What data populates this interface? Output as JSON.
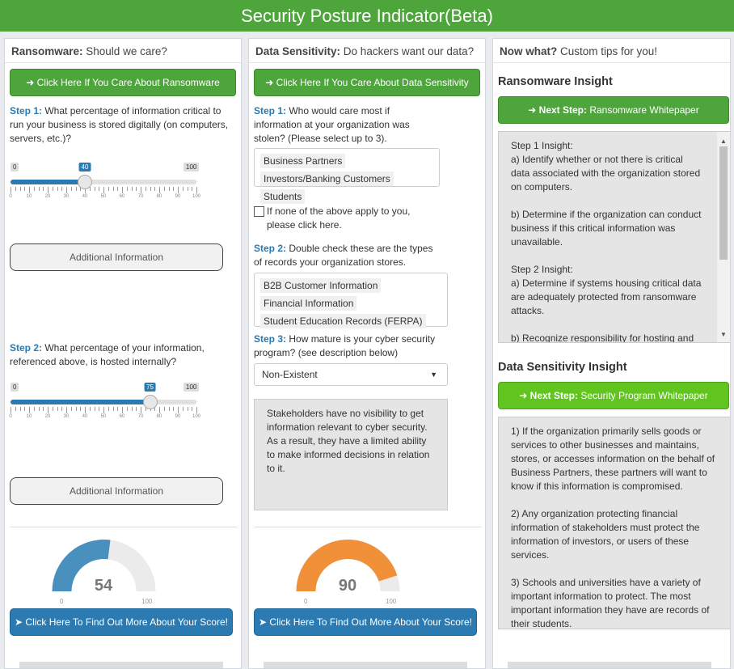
{
  "app": {
    "title": "Security Posture Indicator(Beta)"
  },
  "ransomware": {
    "header_bold": "Ransomware:",
    "header_rest": " Should we care?",
    "care_button": "Click Here If You Care About Ransomware",
    "step1_label": "Step 1:",
    "step1_text": " What percentage of information critical to run your business is stored digitally (on computers, servers, etc.)?",
    "slider1": {
      "min": 0,
      "max": 100,
      "value": 40,
      "min_label": "0",
      "max_label": "100",
      "value_label": "40",
      "ticks": [
        "0",
        "10",
        "20",
        "30",
        "40",
        "50",
        "60",
        "70",
        "80",
        "90",
        "100"
      ]
    },
    "additional_info_1": "Additional Information",
    "step2_label": "Step 2:",
    "step2_text": " What percentage of your information, referenced above, is hosted internally?",
    "slider2": {
      "min": 0,
      "max": 100,
      "value": 75,
      "min_label": "0",
      "max_label": "100",
      "value_label": "75",
      "ticks": [
        "0",
        "10",
        "20",
        "30",
        "40",
        "50",
        "60",
        "70",
        "80",
        "90",
        "100"
      ]
    },
    "additional_info_2": "Additional Information",
    "gauge": {
      "value": 54,
      "value_label": "54",
      "min": 0,
      "max": 100,
      "min_label": "0",
      "max_label": "100",
      "color": "#4a90be"
    },
    "score_button": "Click Here To Find Out More About Your Score!"
  },
  "data_sensitivity": {
    "header_bold": "Data Sensitivity:",
    "header_rest": " Do hackers want our data?",
    "care_button": "Click Here If You Care About Data Sensitivity",
    "step1_label": "Step 1:",
    "step1_text": " Who would care most if information at your organization was stolen? (Please select up to 3).",
    "step1_tags": [
      "Business Partners",
      "Investors/Banking Customers",
      "Students"
    ],
    "none_checkbox": "If none of the above apply to you, please click here.",
    "step2_label": "Step 2:",
    "step2_text": " Double check these are the types of records your organization stores.",
    "step2_tags": [
      "B2B Customer Information",
      "Financial Information",
      "Student Education Records (FERPA)"
    ],
    "step3_label": "Step 3:",
    "step3_text": " How mature is your cyber security program? (see description below)",
    "maturity_select": "Non-Existent",
    "maturity_description": "Stakeholders have no visibility to get information relevant to cyber security. As a result, they have a limited ability to make informed decisions in relation to it.",
    "gauge": {
      "value": 90,
      "value_label": "90",
      "min": 0,
      "max": 100,
      "min_label": "0",
      "max_label": "100",
      "color": "#f0913a"
    },
    "score_button": "Click Here To Find Out More About Your Score!"
  },
  "now_what": {
    "header_bold": "Now what?",
    "header_rest": " Custom tips for you!",
    "ransomware_title": "Ransomware Insight",
    "ransomware_button_bold": "Next Step:",
    "ransomware_button_rest": " Ransomware Whitepaper",
    "ransomware_insight": [
      "Step 1 Insight:",
      "a) Identify whether or not there is critical data associated with the organization stored on computers.",
      "",
      "b) Determine if the organization can conduct business if this critical information was unavailable.",
      "",
      "Step 2 Insight:",
      "a) Determine if systems housing critical data are adequately protected from ransomware attacks.",
      "",
      "b) Recognize responsibility for hosting and"
    ],
    "data_title": "Data Sensitivity Insight",
    "data_button_bold": "Next Step:",
    "data_button_rest": " Security Program Whitepaper",
    "data_insight": [
      "1)  If the organization primarily sells goods or services to other businesses and maintains, stores, or accesses information on the behalf of Business Partners, these partners will want to know if this information is compromised.",
      "",
      "2)  Any organization protecting financial information of stakeholders must protect the information of investors, or users of these services.",
      "",
      "3)  Schools and universities have a variety of important information to protect. The most important information they have are records of their students."
    ]
  },
  "colors": {
    "header_green": "#4ea53b",
    "bright_green": "#61c41f",
    "blue": "#2b7bb2",
    "gauge_blue": "#4a90be",
    "gauge_orange": "#f0913a"
  }
}
